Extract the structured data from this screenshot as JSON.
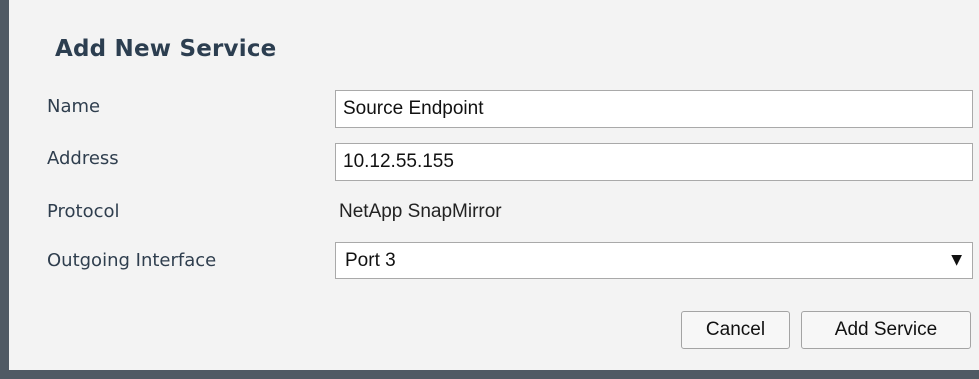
{
  "dialog": {
    "title": "Add New Service",
    "fields": {
      "name": {
        "label": "Name",
        "value": "Source Endpoint"
      },
      "address": {
        "label": "Address",
        "value": "10.12.55.155"
      },
      "protocol": {
        "label": "Protocol",
        "value": "NetApp SnapMirror"
      },
      "interface": {
        "label": "Outgoing Interface",
        "value": "Port 3",
        "caret": "▼"
      }
    },
    "buttons": {
      "cancel": "Cancel",
      "add": "Add Service"
    }
  },
  "icons": {
    "dropdown": "chevron-down-icon"
  },
  "colors": {
    "frame_border": "#505a64",
    "dialog_background": "#f3f3f3",
    "title_text": "#2c3e50"
  }
}
